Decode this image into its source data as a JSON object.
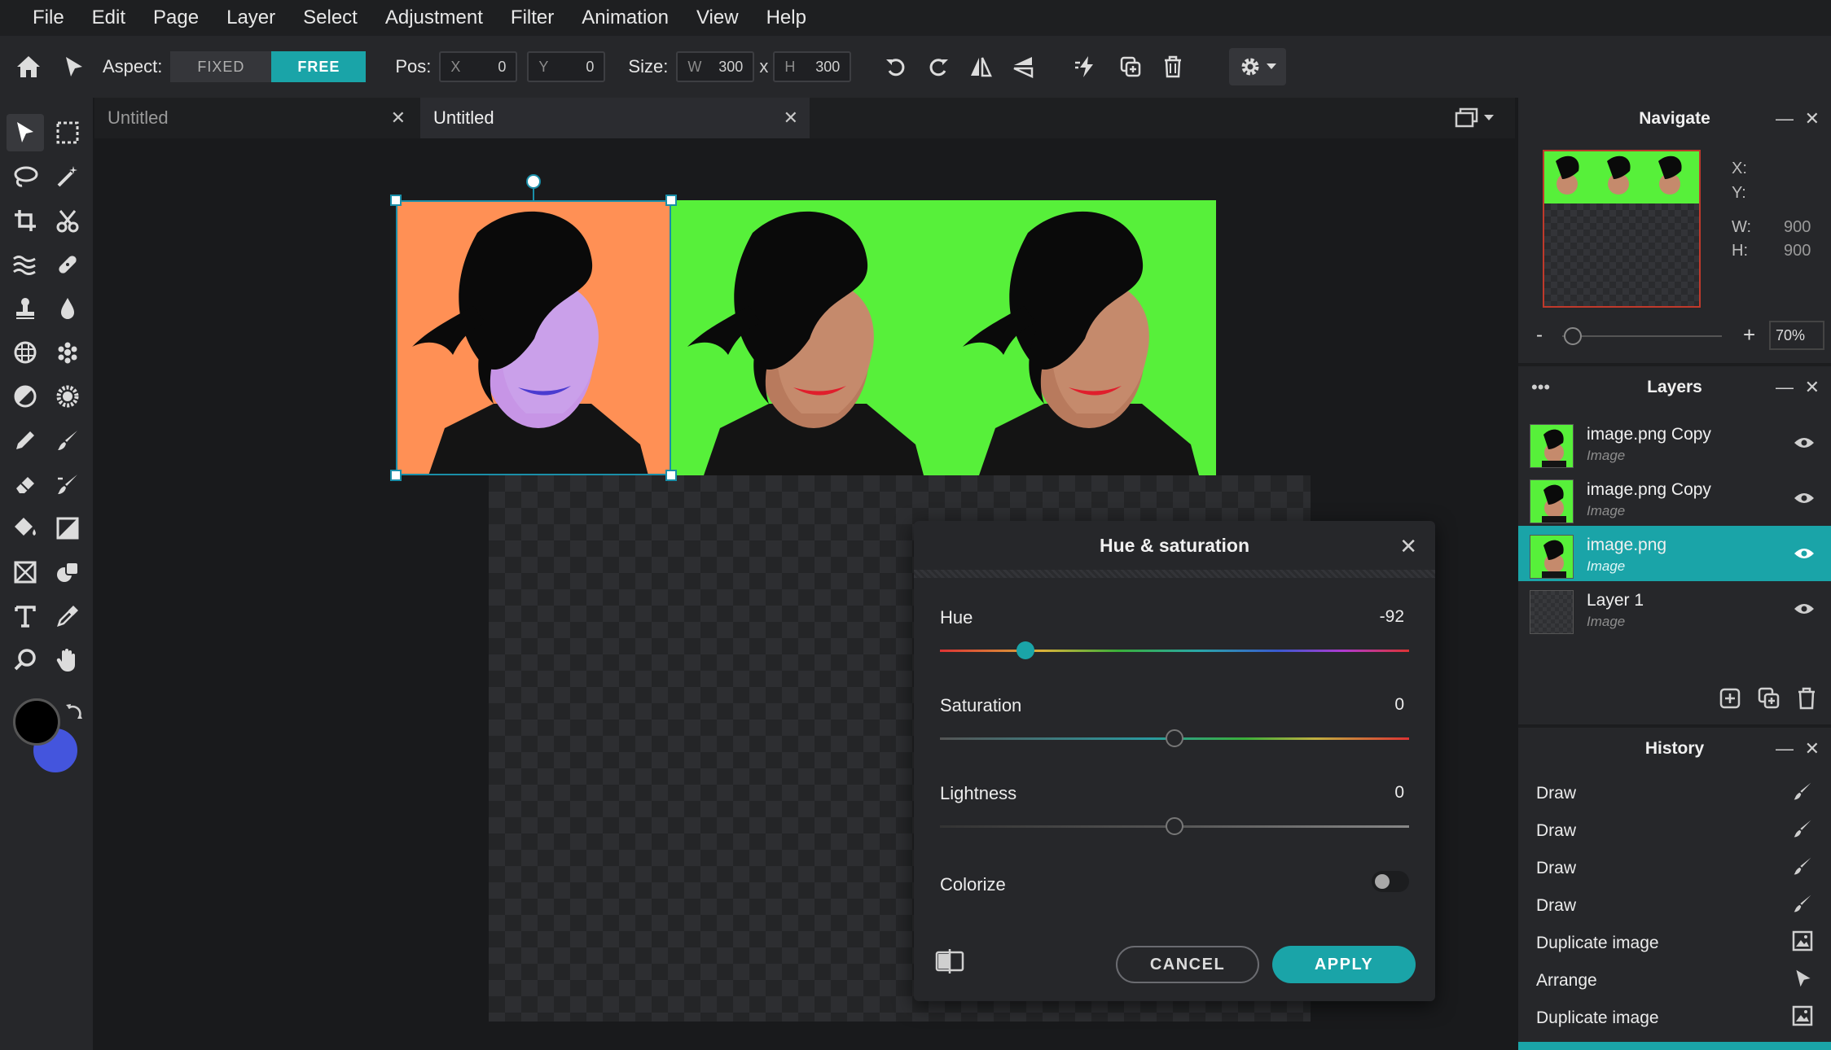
{
  "menu": [
    "File",
    "Edit",
    "Page",
    "Layer",
    "Select",
    "Adjustment",
    "Filter",
    "Animation",
    "View",
    "Help"
  ],
  "toolbar": {
    "aspect_label": "Aspect:",
    "aspect_fixed": "FIXED",
    "aspect_free": "FREE",
    "pos_label": "Pos:",
    "x_prefix": "X",
    "x_value": "0",
    "y_prefix": "Y",
    "y_value": "0",
    "size_label": "Size:",
    "w_prefix": "W",
    "w_value": "300",
    "times": "x",
    "h_prefix": "H",
    "h_value": "300"
  },
  "tabs": [
    {
      "title": "Untitled",
      "close": "✕"
    },
    {
      "title": "Untitled",
      "close": "✕"
    }
  ],
  "navigate": {
    "title": "Navigate",
    "x_label": "X:",
    "y_label": "Y:",
    "w_label": "W:",
    "w_value": "900",
    "h_label": "H:",
    "h_value": "900",
    "zoom_minus": "-",
    "zoom_plus": "+",
    "zoom_value": "70%"
  },
  "layers": {
    "title": "Layers",
    "items": [
      {
        "name": "image.png Copy",
        "kind": "Image"
      },
      {
        "name": "image.png Copy",
        "kind": "Image"
      },
      {
        "name": "image.png",
        "kind": "Image"
      },
      {
        "name": "Layer 1",
        "kind": "Image"
      }
    ]
  },
  "history": {
    "title": "History",
    "items": [
      "Draw",
      "Draw",
      "Draw",
      "Draw",
      "Duplicate image",
      "Arrange",
      "Duplicate image"
    ]
  },
  "dialog": {
    "title": "Hue & saturation",
    "hue_label": "Hue",
    "hue_value": "-92",
    "saturation_label": "Saturation",
    "saturation_value": "0",
    "lightness_label": "Lightness",
    "lightness_value": "0",
    "colorize_label": "Colorize",
    "cancel": "CANCEL",
    "apply": "APPLY"
  },
  "colors": {
    "accent": "#1aa4a8",
    "foreground": "#000000",
    "background": "#4455dd",
    "green_bg": "#57f03a",
    "orange_bg": "#ff9055"
  }
}
